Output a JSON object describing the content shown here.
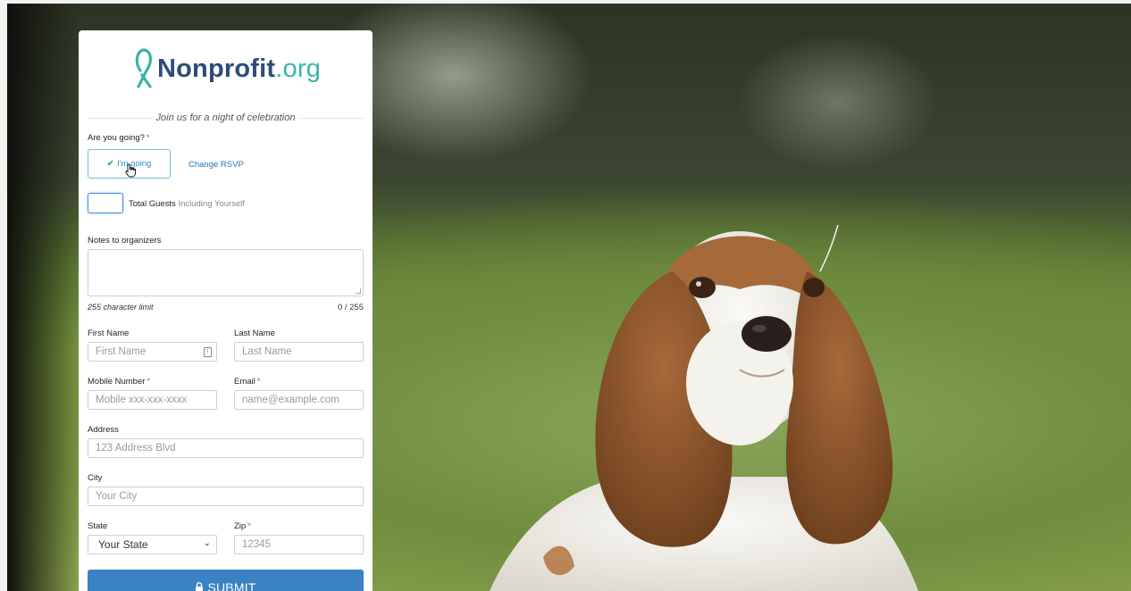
{
  "brand": {
    "name_bold": "Nonprofit",
    "name_suffix": ".org",
    "primary_color": "#2e4c79",
    "accent_color": "#3bb3a7"
  },
  "form": {
    "tagline": "Join us for a night of celebration",
    "rsvp": {
      "question": "Are you going?",
      "required_mark": "*",
      "going_label": "I'm going",
      "change_label": "Change RSVP"
    },
    "guests": {
      "value": "",
      "label_bold": "Total Guests",
      "label_hint": "Including Yourself"
    },
    "notes": {
      "label": "Notes to organizers",
      "value": "",
      "limit_text": "255 character limit",
      "counter": "0 / 255"
    },
    "first_name": {
      "label": "First Name",
      "placeholder": "First Name"
    },
    "last_name": {
      "label": "Last Name",
      "placeholder": "Last Name"
    },
    "mobile": {
      "label": "Mobile Number",
      "required_mark": "*",
      "placeholder": "Mobile xxx-xxx-xxxx"
    },
    "email": {
      "label": "Email",
      "required_mark": "*",
      "placeholder": "name@example.com"
    },
    "address": {
      "label": "Address",
      "placeholder": "123 Address Blvd"
    },
    "city": {
      "label": "City",
      "placeholder": "Your City"
    },
    "state": {
      "label": "State",
      "selected": "Your State"
    },
    "zip": {
      "label": "Zip",
      "required_mark": "*",
      "placeholder": "12345"
    },
    "submit_label": "SUBMIT",
    "submit_color": "#3a82c4"
  },
  "icons": {
    "logo": "ribbon-icon",
    "going_check": "check-icon",
    "submit_lock": "lock-icon",
    "state_dropdown": "chevron-down-icon"
  }
}
